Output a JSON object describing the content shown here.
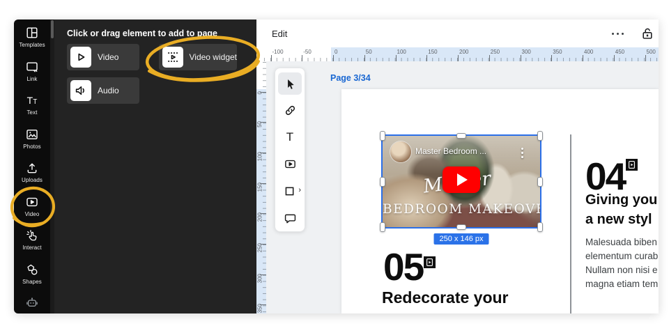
{
  "sidebar": {
    "items": [
      {
        "id": "templates",
        "label": "Templates",
        "icon": "templates-icon"
      },
      {
        "id": "link",
        "label": "Link",
        "icon": "link-icon"
      },
      {
        "id": "text",
        "label": "Text",
        "icon": "text-icon"
      },
      {
        "id": "photos",
        "label": "Photos",
        "icon": "photos-icon"
      },
      {
        "id": "uploads",
        "label": "Uploads",
        "icon": "upload-icon"
      },
      {
        "id": "video",
        "label": "Video",
        "icon": "video-icon"
      },
      {
        "id": "interact",
        "label": "Interact",
        "icon": "interact-icon"
      },
      {
        "id": "shapes",
        "label": "Shapes",
        "icon": "shapes-icon"
      },
      {
        "id": "assistant",
        "label": "",
        "icon": "robot-icon"
      }
    ]
  },
  "panel": {
    "heading": "Click or drag element to add to page",
    "buttons": [
      {
        "id": "video",
        "label": "Video",
        "icon": "play-icon"
      },
      {
        "id": "video-widget",
        "label": "Video widget",
        "icon": "video-widget-icon"
      },
      {
        "id": "audio",
        "label": "Audio",
        "icon": "speaker-icon"
      }
    ]
  },
  "topbar": {
    "edit_label": "Edit"
  },
  "rulers": {
    "horizontal": {
      "labels": [
        "-100",
        "-50",
        "0",
        "50",
        "100",
        "150",
        "200",
        "250",
        "300",
        "350",
        "400",
        "450",
        "500"
      ]
    },
    "vertical": {
      "labels": [
        "0",
        "50",
        "100",
        "150",
        "200",
        "250",
        "300",
        "350"
      ]
    }
  },
  "toolbar": {
    "items": [
      {
        "id": "select",
        "icon": "cursor-icon",
        "active": true
      },
      {
        "id": "link",
        "icon": "link-icon",
        "active": false
      },
      {
        "id": "text",
        "icon": "text-tool-icon",
        "active": false
      },
      {
        "id": "video",
        "icon": "video-tool-icon",
        "active": false
      },
      {
        "id": "shape",
        "icon": "shape-icon",
        "active": false
      },
      {
        "id": "comment",
        "icon": "comment-icon",
        "active": false
      }
    ]
  },
  "canvas": {
    "page_indicator": "Page 3/34",
    "video": {
      "title": "Master Bedroom ...",
      "script_text": "Master",
      "caption": "BEDROOM MAKEOVER",
      "size_badge": "250 x 146 px"
    },
    "left_section": {
      "number": "05",
      "heading": "Redecorate your"
    },
    "right_section": {
      "number": "04",
      "heading_line1": "Giving you",
      "heading_line2": "a new styl",
      "body": [
        "Malesuada biben",
        "elementum curab",
        "Nullam non nisi e",
        "magna etiam tem"
      ]
    }
  },
  "colors": {
    "annotation_yellow": "#e9ad24",
    "selection_blue": "#2b6fe8",
    "page_label_blue": "#1967d2",
    "youtube_red": "#ff0000"
  }
}
